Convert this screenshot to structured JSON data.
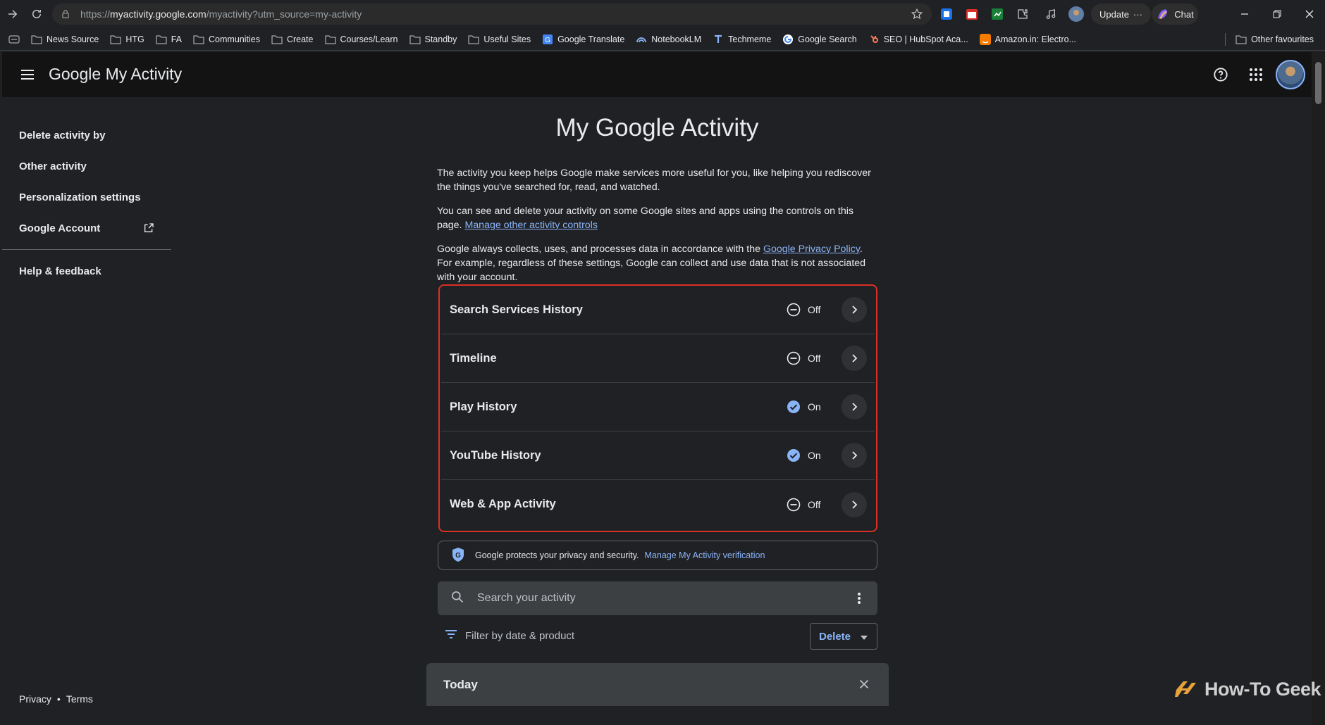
{
  "browser": {
    "url_prefix": "https://",
    "url_host": "myactivity.google.com",
    "url_path": "/myactivity?utm_source=my-activity",
    "update_label": "Update",
    "chat_label": "Chat",
    "bookmarks": [
      {
        "label": "News Source",
        "icon": "folder-icon"
      },
      {
        "label": "HTG",
        "icon": "folder-icon"
      },
      {
        "label": "FA",
        "icon": "folder-icon"
      },
      {
        "label": "Communities",
        "icon": "folder-icon"
      },
      {
        "label": "Create",
        "icon": "folder-icon"
      },
      {
        "label": "Courses/Learn",
        "icon": "folder-icon"
      },
      {
        "label": "Standby",
        "icon": "folder-icon"
      },
      {
        "label": "Useful Sites",
        "icon": "folder-icon"
      },
      {
        "label": "Google Translate",
        "icon": "translate-icon"
      },
      {
        "label": "NotebookLM",
        "icon": "notebooklm-icon"
      },
      {
        "label": "Techmeme",
        "icon": "techmeme-icon"
      },
      {
        "label": "Google Search",
        "icon": "google-icon"
      },
      {
        "label": "SEO | HubSpot Aca...",
        "icon": "hubspot-icon"
      },
      {
        "label": "Amazon.in: Electro...",
        "icon": "amazon-icon"
      }
    ],
    "other_favourites": "Other favourites"
  },
  "header": {
    "logo_google": "Google",
    "logo_product": "My Activity"
  },
  "sidebar": {
    "items": [
      {
        "label": "Delete activity by"
      },
      {
        "label": "Other activity"
      },
      {
        "label": "Personalization settings"
      },
      {
        "label": "Google Account"
      }
    ],
    "help": "Help & feedback",
    "footer": {
      "privacy": "Privacy",
      "sep": "•",
      "terms": "Terms"
    }
  },
  "main": {
    "title": "My Google Activity",
    "para1": "The activity you keep helps Google make services more useful for you, like helping you rediscover the things you've searched for, read, and watched.",
    "para2_text": "You can see and delete your activity on some Google sites and apps using the controls on this page.",
    "para2_link": "Manage other activity controls",
    "para3_text_a": "Google always collects, uses, and processes data in accordance with the",
    "para3_link": "Google Privacy Policy",
    "para3_text_b": ". For example, regardless of these settings, Google can collect and use data that is not associated with your account.",
    "controls": [
      {
        "name": "Search Services History",
        "status": "Off",
        "on": false
      },
      {
        "name": "Timeline",
        "status": "Off",
        "on": false
      },
      {
        "name": "Play History",
        "status": "On",
        "on": true
      },
      {
        "name": "YouTube History",
        "status": "On",
        "on": true
      },
      {
        "name": "Web & App Activity",
        "status": "Off",
        "on": false
      }
    ],
    "privacy_text": "Google protects your privacy and security.",
    "privacy_link": "Manage My Activity verification",
    "search_placeholder": "Search your activity",
    "filter_label": "Filter by date & product",
    "delete_label": "Delete",
    "today_label": "Today"
  },
  "watermark": "How-To Geek",
  "colors": {
    "accent": "#8ab4f8",
    "highlight_border": "#d93025",
    "background": "#202124"
  }
}
